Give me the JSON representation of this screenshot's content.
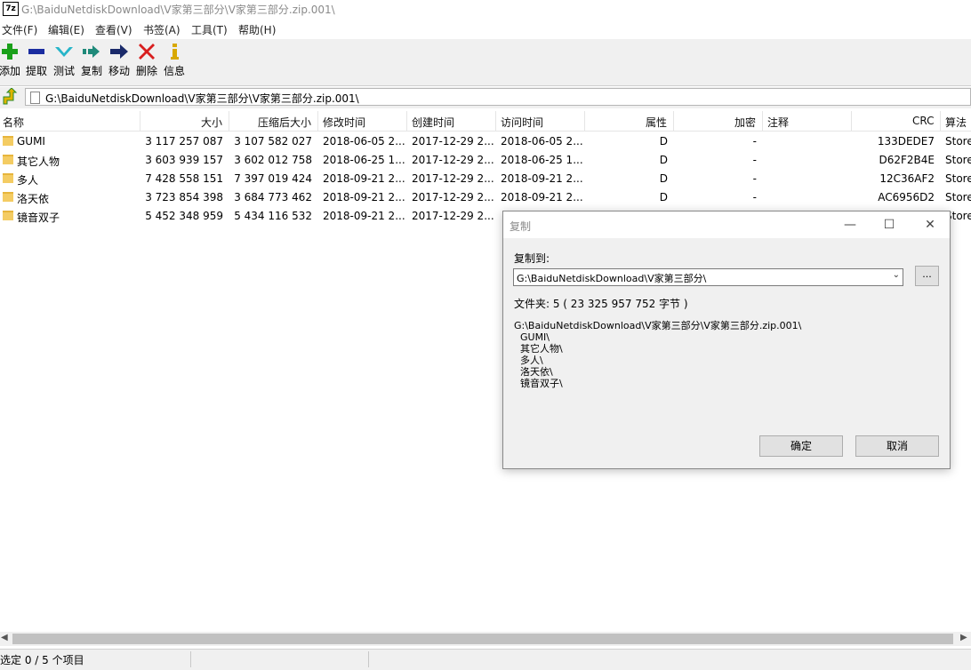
{
  "window": {
    "app_icon_text": "7z",
    "title": "G:\\BaiduNetdiskDownload\\V家第三部分\\V家第三部分.zip.001\\"
  },
  "menu": [
    "文件(F)",
    "编辑(E)",
    "查看(V)",
    "书签(A)",
    "工具(T)",
    "帮助(H)"
  ],
  "toolbar": {
    "add": {
      "label": "添加",
      "icon": "plus-icon",
      "color": "#1aa01a"
    },
    "extract": {
      "label": "提取",
      "icon": "minus-icon",
      "color": "#1a2ca0"
    },
    "test": {
      "label": "测试",
      "icon": "check-icon",
      "color": "#27b5c9"
    },
    "copy": {
      "label": "复制",
      "icon": "copy-arrow-icon",
      "color": "#1f8a7a"
    },
    "move": {
      "label": "移动",
      "icon": "arrow-right-icon",
      "color": "#1a2a6a"
    },
    "delete": {
      "label": "删除",
      "icon": "x-icon",
      "color": "#d81e1e"
    },
    "info": {
      "label": "信息",
      "icon": "info-icon",
      "color": "#d8a800"
    }
  },
  "address": {
    "path": "G:\\BaiduNetdiskDownload\\V家第三部分\\V家第三部分.zip.001\\"
  },
  "columns": {
    "name": "名称",
    "size": "大小",
    "packed": "压缩后大小",
    "modified": "修改时间",
    "created": "创建时间",
    "accessed": "访问时间",
    "attributes": "属性",
    "encrypted": "加密",
    "comment": "注释",
    "crc": "CRC",
    "method": "算法"
  },
  "rows": [
    {
      "name": "GUMI",
      "size": "3 117 257 087",
      "packed": "3 107 582 027",
      "modified": "2018-06-05 2...",
      "created": "2017-12-29 2...",
      "accessed": "2018-06-05 2...",
      "attributes": "D",
      "encrypted": "-",
      "comment": "",
      "crc": "133DEDE7",
      "method": "Store"
    },
    {
      "name": "其它人物",
      "size": "3 603 939 157",
      "packed": "3 602 012 758",
      "modified": "2018-06-25 1...",
      "created": "2017-12-29 2...",
      "accessed": "2018-06-25 1...",
      "attributes": "D",
      "encrypted": "-",
      "comment": "",
      "crc": "D62F2B4E",
      "method": "Store"
    },
    {
      "name": "多人",
      "size": "7 428 558 151",
      "packed": "7 397 019 424",
      "modified": "2018-09-21 2...",
      "created": "2017-12-29 2...",
      "accessed": "2018-09-21 2...",
      "attributes": "D",
      "encrypted": "-",
      "comment": "",
      "crc": "12C36AF2",
      "method": "Store"
    },
    {
      "name": "洛天依",
      "size": "3 723 854 398",
      "packed": "3 684 773 462",
      "modified": "2018-09-21 2...",
      "created": "2017-12-29 2...",
      "accessed": "2018-09-21 2...",
      "attributes": "D",
      "encrypted": "-",
      "comment": "",
      "crc": "AC6956D2",
      "method": "Store"
    },
    {
      "name": "镜音双子",
      "size": "5 452 348 959",
      "packed": "5 434 116 532",
      "modified": "2018-09-21 2...",
      "created": "2017-12-29 2...",
      "accessed": "",
      "attributes": "",
      "encrypted": "",
      "comment": "",
      "crc": "",
      "method": "Store"
    }
  ],
  "status": {
    "selection": "选定 0 / 5 个项目"
  },
  "dialog": {
    "title": "复制",
    "copy_to_label": "复制到:",
    "path_value": "G:\\BaiduNetdiskDownload\\V家第三部分\\",
    "browse_label": "...",
    "summary": "文件夹: 5   ( 23 325 957 752 字节 )",
    "tree": [
      "G:\\BaiduNetdiskDownload\\V家第三部分\\V家第三部分.zip.001\\",
      "  GUMI\\",
      "  其它人物\\",
      "  多人\\",
      "  洛天依\\",
      "  镜音双子\\"
    ],
    "ok_label": "确定",
    "cancel_label": "取消",
    "minimize": "—",
    "maximize": "☐",
    "close": "✕"
  }
}
